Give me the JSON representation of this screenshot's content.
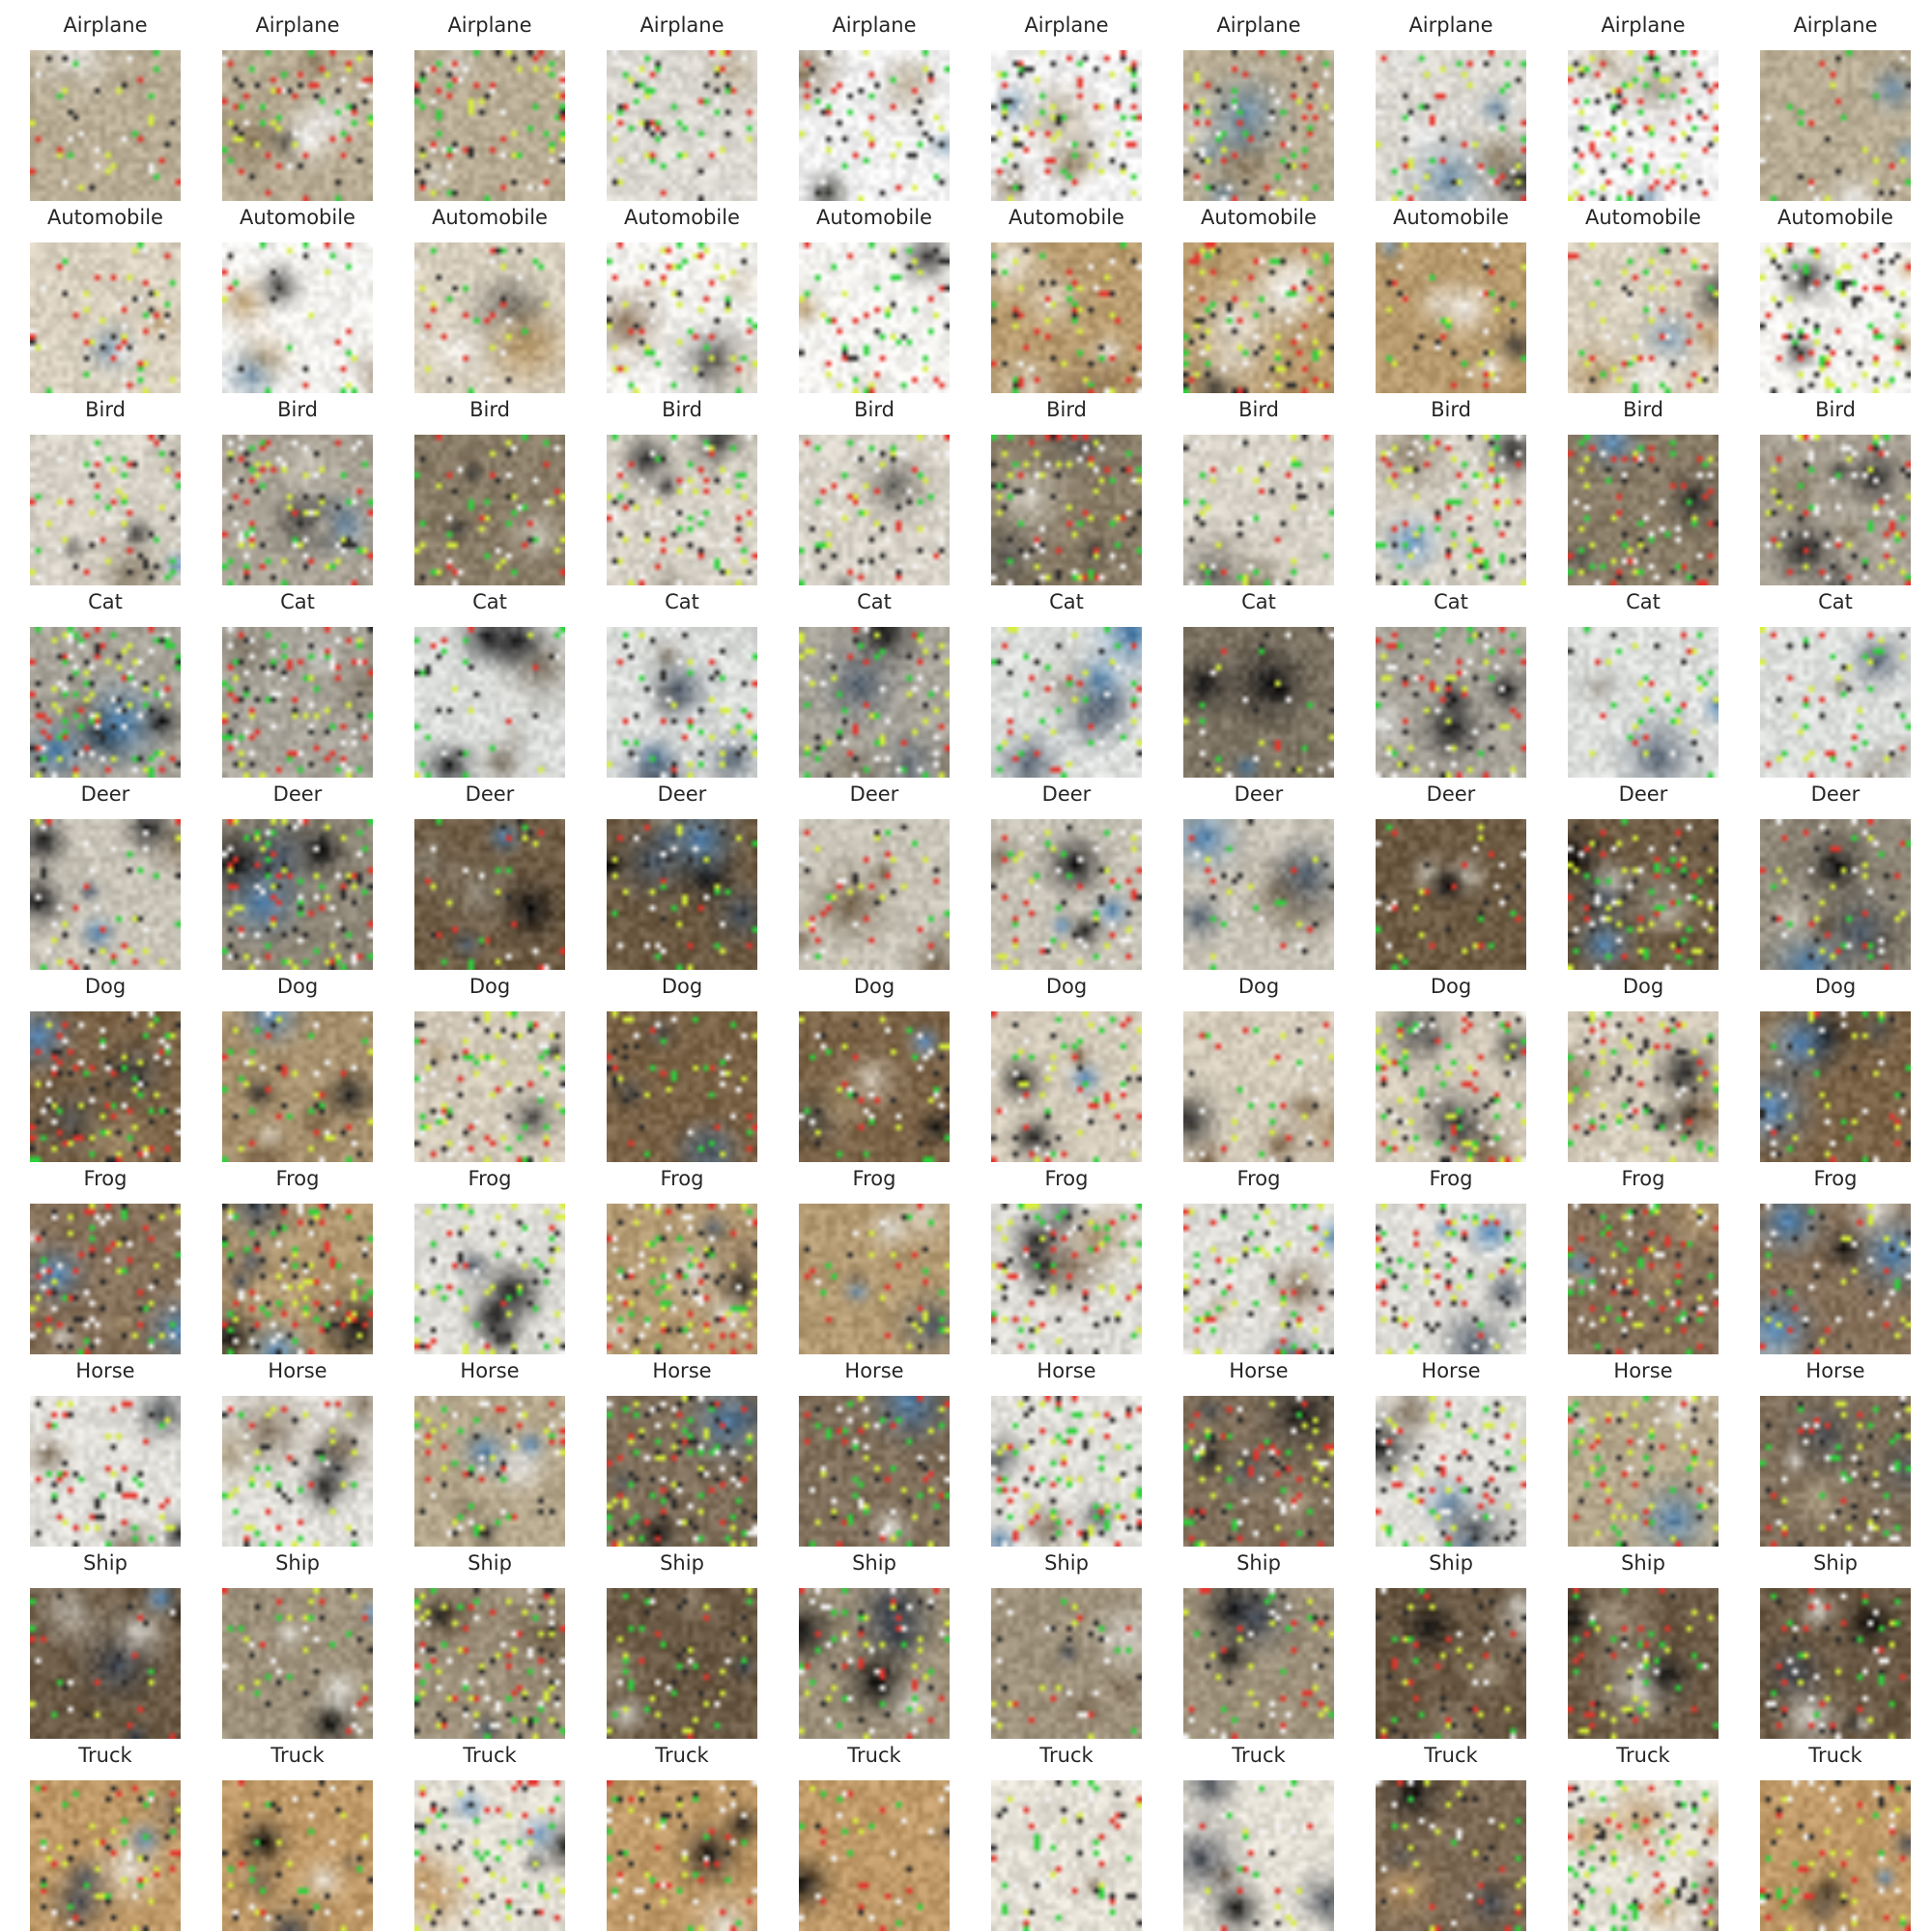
{
  "rows": [
    {
      "label": "Airplane",
      "palette": [
        "#f2f2f3",
        "#dcd9d2",
        "#b9ad95",
        "#8c7b60",
        "#3a3a33",
        "#6f8fa8"
      ]
    },
    {
      "label": "Automobile",
      "palette": [
        "#f4f3f0",
        "#d9d0bf",
        "#b89b6e",
        "#8a7258",
        "#2e2c2a",
        "#7f9bb2"
      ]
    },
    {
      "label": "Bird",
      "palette": [
        "#d8d3c8",
        "#aaa396",
        "#8a7d68",
        "#5c5a55",
        "#222222",
        "#5e8fbd"
      ]
    },
    {
      "label": "Cat",
      "palette": [
        "#dcdedc",
        "#a9a59b",
        "#7f7565",
        "#4e5b6b",
        "#0e0e10",
        "#3f77a8"
      ]
    },
    {
      "label": "Deer",
      "palette": [
        "#c9c4b8",
        "#8e8677",
        "#6d5b44",
        "#445262",
        "#0a0a0c",
        "#4d7fae"
      ]
    },
    {
      "label": "Dog",
      "palette": [
        "#d4cbbb",
        "#a7916f",
        "#7c6448",
        "#4a4a48",
        "#141414",
        "#5b8dbf"
      ]
    },
    {
      "label": "Frog",
      "palette": [
        "#dedcd6",
        "#b39a73",
        "#85705a",
        "#4b5562",
        "#121212",
        "#4f86b8"
      ]
    },
    {
      "label": "Horse",
      "palette": [
        "#e2e0da",
        "#b6a88d",
        "#7f6f5b",
        "#505458",
        "#161616",
        "#527fa8"
      ]
    },
    {
      "label": "Ship",
      "palette": [
        "#d9d7d0",
        "#9f927c",
        "#6b5a45",
        "#3c4450",
        "#080808",
        "#5d93c6"
      ]
    },
    {
      "label": "Truck",
      "palette": [
        "#e4e0d6",
        "#c09a68",
        "#7d6a55",
        "#464b54",
        "#101010",
        "#6a93ba"
      ]
    }
  ],
  "accent_colors": [
    "#2bd33a",
    "#d8f03a",
    "#e7332b",
    "#f4f4f4",
    "#2a2a2a"
  ]
}
